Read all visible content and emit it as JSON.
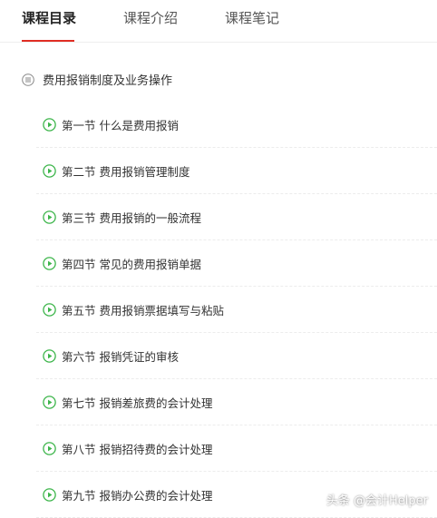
{
  "tabs": [
    {
      "label": "课程目录",
      "active": true
    },
    {
      "label": "课程介绍",
      "active": false
    },
    {
      "label": "课程笔记",
      "active": false
    }
  ],
  "accent_color": "#e02e24",
  "play_icon_color": "#3cb54a",
  "chapter": {
    "icon": "list-icon",
    "title": "费用报销制度及业务操作"
  },
  "lessons": [
    {
      "title": "第一节 什么是费用报销"
    },
    {
      "title": "第二节 费用报销管理制度"
    },
    {
      "title": "第三节 费用报销的一般流程"
    },
    {
      "title": "第四节 常见的费用报销单据"
    },
    {
      "title": "第五节 费用报销票据填写与粘贴"
    },
    {
      "title": "第六节 报销凭证的审核"
    },
    {
      "title": "第七节 报销差旅费的会计处理"
    },
    {
      "title": "第八节 报销招待费的会计处理"
    },
    {
      "title": "第九节 报销办公费的会计处理"
    }
  ],
  "watermark": "头条 @会计Helper"
}
